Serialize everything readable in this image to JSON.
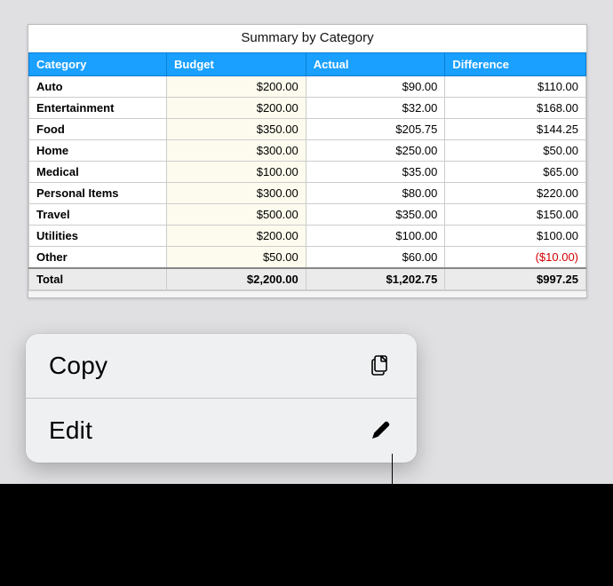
{
  "table": {
    "title": "Summary by Category",
    "headers": {
      "category": "Category",
      "budget": "Budget",
      "actual": "Actual",
      "difference": "Difference"
    },
    "rows": [
      {
        "category": "Auto",
        "budget": "$200.00",
        "actual": "$90.00",
        "difference": "$110.00",
        "neg": false
      },
      {
        "category": "Entertainment",
        "budget": "$200.00",
        "actual": "$32.00",
        "difference": "$168.00",
        "neg": false
      },
      {
        "category": "Food",
        "budget": "$350.00",
        "actual": "$205.75",
        "difference": "$144.25",
        "neg": false
      },
      {
        "category": "Home",
        "budget": "$300.00",
        "actual": "$250.00",
        "difference": "$50.00",
        "neg": false
      },
      {
        "category": "Medical",
        "budget": "$100.00",
        "actual": "$35.00",
        "difference": "$65.00",
        "neg": false
      },
      {
        "category": "Personal Items",
        "budget": "$300.00",
        "actual": "$80.00",
        "difference": "$220.00",
        "neg": false
      },
      {
        "category": "Travel",
        "budget": "$500.00",
        "actual": "$350.00",
        "difference": "$150.00",
        "neg": false
      },
      {
        "category": "Utilities",
        "budget": "$200.00",
        "actual": "$100.00",
        "difference": "$100.00",
        "neg": false
      },
      {
        "category": "Other",
        "budget": "$50.00",
        "actual": "$60.00",
        "difference": "($10.00)",
        "neg": true
      }
    ],
    "total": {
      "label": "Total",
      "budget": "$2,200.00",
      "actual": "$1,202.75",
      "difference": "$997.25"
    }
  },
  "menu": {
    "copy_label": "Copy",
    "edit_label": "Edit"
  }
}
